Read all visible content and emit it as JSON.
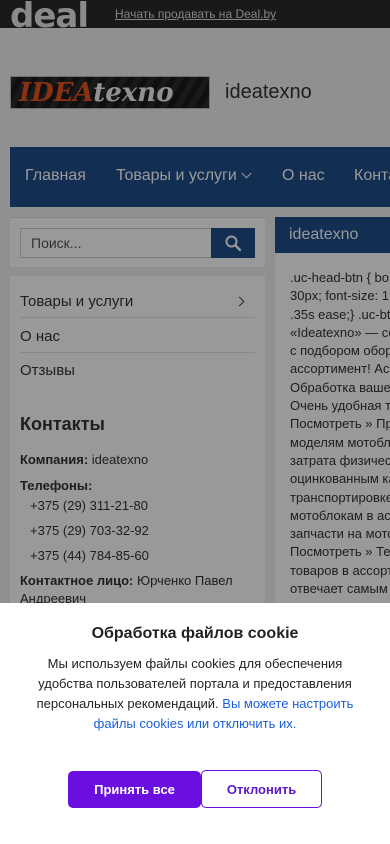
{
  "topbar": {
    "logo": "deal",
    "sell_link": "Начать продавать на Deal.by"
  },
  "header": {
    "brand_logo": {
      "idea": "IDEA",
      "texno": "texno"
    },
    "shop_name": "ideatexno"
  },
  "nav": {
    "items": [
      {
        "label": "Главная"
      },
      {
        "label": "Товары и услуги",
        "has_dropdown": true
      },
      {
        "label": "О нас"
      },
      {
        "label": "Конта"
      }
    ]
  },
  "search": {
    "placeholder": "Поиск...",
    "button_icon": "search-icon"
  },
  "sidebar": {
    "menu": [
      {
        "label": "Товары и услуги",
        "has_arrow": true
      },
      {
        "label": "О нас"
      },
      {
        "label": "Отзывы"
      }
    ],
    "contacts": {
      "title": "Контакты",
      "company_label": "Компания:",
      "company_value": "ideatexno",
      "phones_label": "Телефоны:",
      "phones": [
        "+375 (29) 311-21-80",
        "+375 (29) 703-32-92",
        "+375 (44) 784-85-60"
      ],
      "person_label": "Контактное лицо:",
      "person_value": "Юрченко Павел Андреевич"
    }
  },
  "content": {
    "heading": "ideatexno",
    "lines": [
      ".uc-head-btn { bo",
      "30px; font-size: 1",
      ".35s ease;} .uc-bt",
      "«Ideatexno» — со",
      "с подбором обор",
      "ассортимент! Ас",
      "Обработка ваше",
      "Очень удобная т",
      "Посмотреть » Пр",
      "моделям мотобл",
      "затрата физичес",
      "оцинкованным ка",
      "транспортировке",
      "мотоблокам в ас",
      "запчасти на мото",
      "Посмотреть » Те",
      "товаров в ассорт",
      "отвечает самым"
    ]
  },
  "cookie": {
    "title": "Обработка файлов cookie",
    "text": "Мы используем файлы cookies для обеспечения удобства пользователей портала и предоставления персональных рекомендаций.",
    "link": "Вы можете настроить файлы cookies или отключить их.",
    "accept": "Принять все",
    "decline": "Отклонить"
  },
  "colors": {
    "nav": "#1f4d8a",
    "topbar": "#2b2b2b",
    "accept": "#6a0fe0",
    "link": "#1a5fd8"
  }
}
